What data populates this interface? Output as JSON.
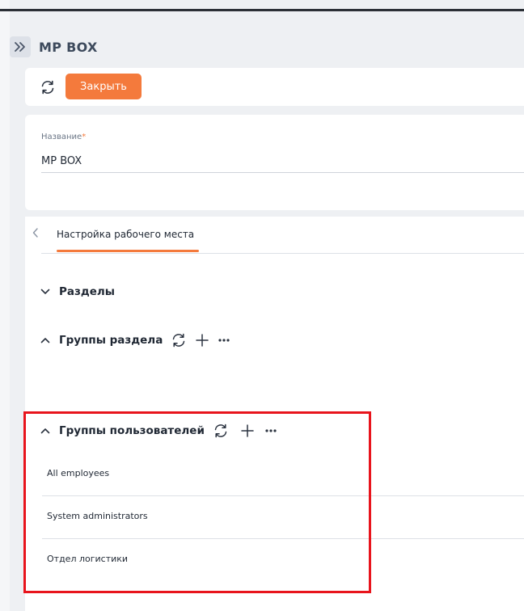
{
  "header": {
    "title": "MP BOX",
    "expand_icon": "double-chevron-right-icon"
  },
  "toolbar": {
    "refresh_icon": "refresh-icon",
    "close_label": "Закрыть"
  },
  "form": {
    "name_label": "Название",
    "required_mark": "*",
    "name_value": "MP BOX"
  },
  "tabs": {
    "back_icon": "chevron-left-icon",
    "active_label": "Настройка рабочего места"
  },
  "sections": {
    "razdely": {
      "title": "Разделы",
      "state": "collapsed"
    },
    "gruppy_razdela": {
      "title": "Группы раздела",
      "state": "expanded"
    },
    "gruppy_polzovateley": {
      "title": "Группы пользователей",
      "state": "expanded",
      "items": [
        {
          "label": "All employees"
        },
        {
          "label": "System administrators"
        },
        {
          "label": "Отдел логистики"
        }
      ]
    }
  },
  "colors": {
    "accent": "#f47a3c",
    "highlight_border": "#e8141c",
    "background": "#eef0f3"
  }
}
